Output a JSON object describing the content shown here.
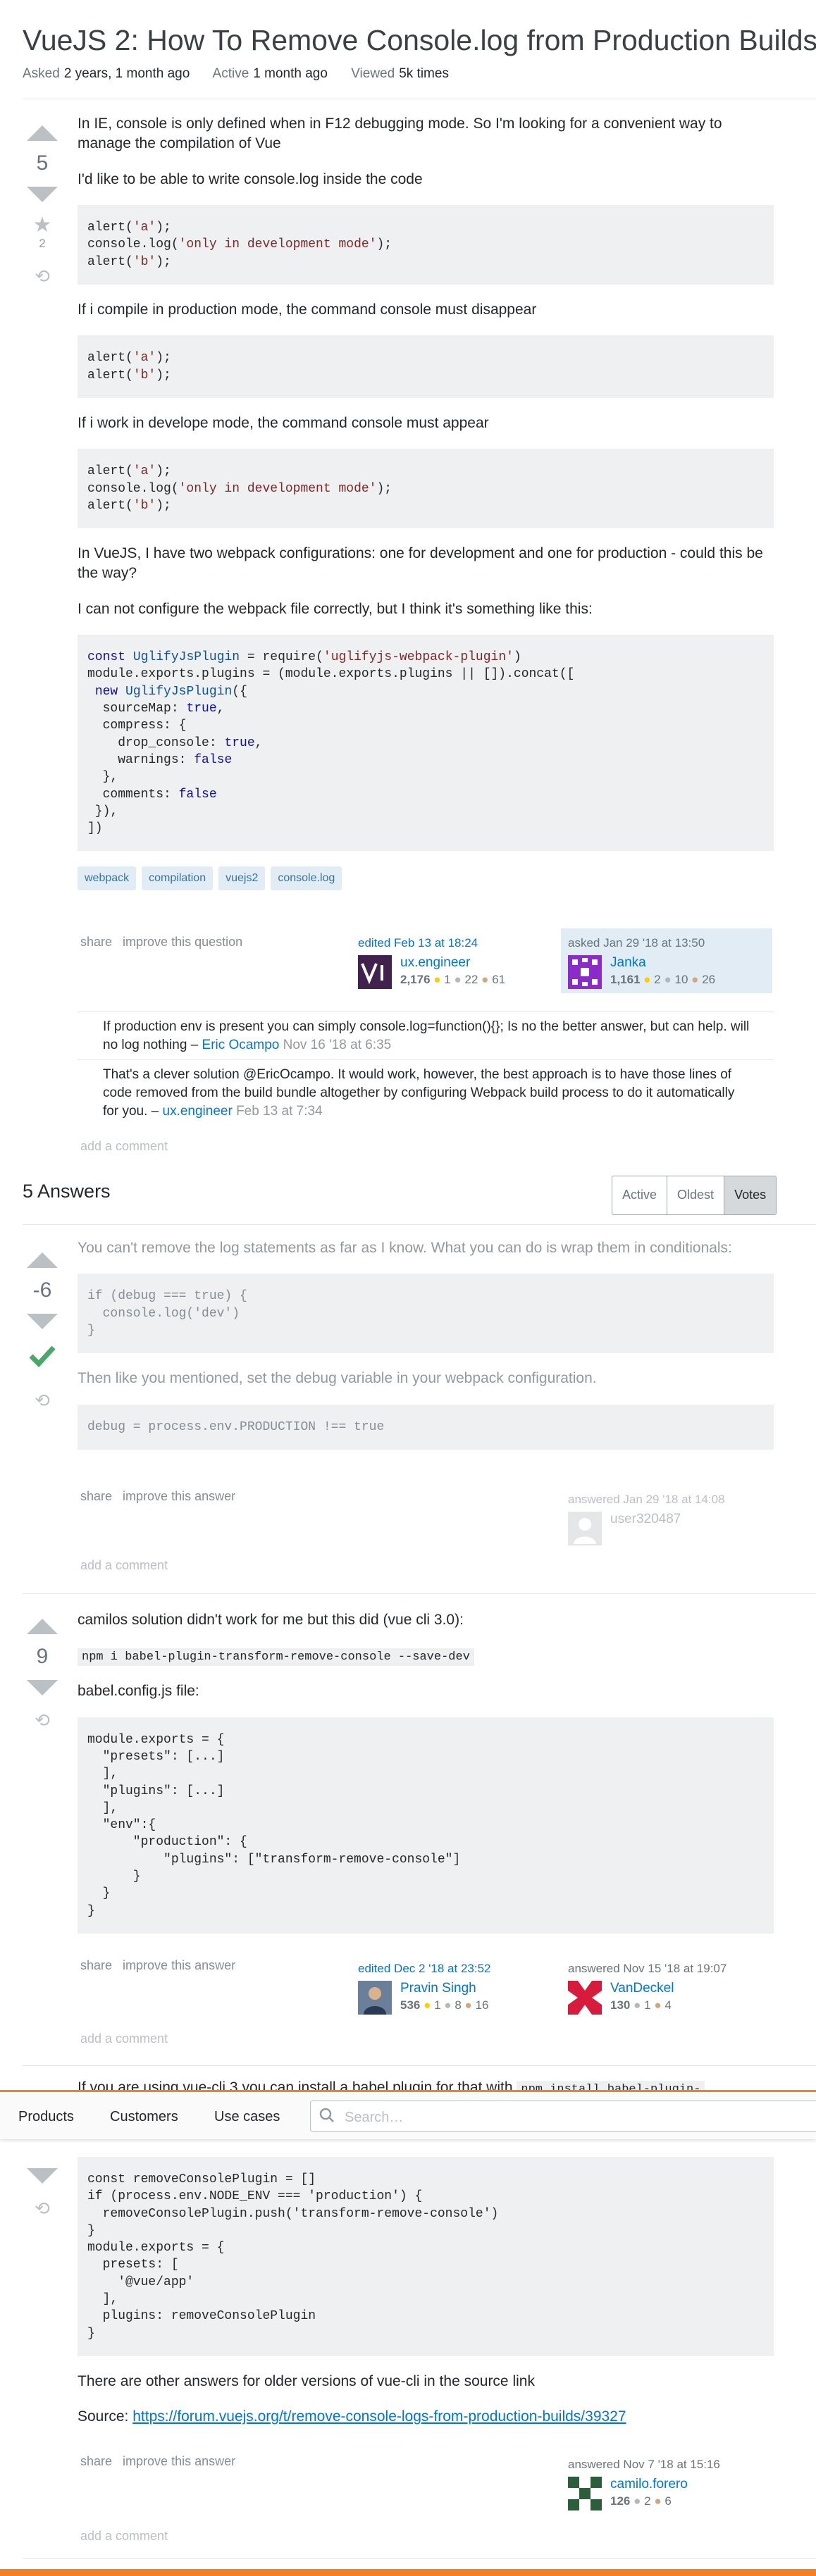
{
  "question": {
    "title": "VueJS 2: How To Remove Console.log from Production Builds?",
    "meta": [
      {
        "label": "Asked",
        "value": "2 years, 1 month ago"
      },
      {
        "label": "Active",
        "value": "1 month ago"
      },
      {
        "label": "Viewed",
        "value": "5k times"
      }
    ],
    "score": "5",
    "fav_count": "2",
    "p1": "In IE, console is only defined when in F12 debugging mode. So I'm looking for a convenient way to manage the compilation of Vue",
    "p2": "I'd like to be able to write console.log inside the code",
    "p3": "If i compile in production mode, the command console must disappear",
    "p4": "If i work in develope mode, the command console must appear",
    "p5": "In VueJS, I have two webpack configurations: one for development and one for production - could this be the way?",
    "p6": "I can not configure the webpack file correctly, but I think it's something like this:",
    "tags": [
      "webpack",
      "compilation",
      "vuejs2",
      "console.log"
    ],
    "actions": {
      "share": "share",
      "improve": "improve this question"
    },
    "editor": {
      "caption": "edited Feb 13 at 18:24",
      "name": "ux.engineer",
      "rep": "2,176",
      "gold": "1",
      "silver": "22",
      "bronze": "61"
    },
    "asker": {
      "caption": "asked Jan 29 '18 at 13:50",
      "name": "Janka",
      "rep": "1,161",
      "gold": "2",
      "silver": "10",
      "bronze": "26"
    },
    "comments": [
      {
        "text": "If production env is present you can simply console.log=function(){}; Is no the better answer, but can help. will no log nothing –",
        "user": "Eric Ocampo",
        "time": "Nov 16 '18 at 6:35"
      },
      {
        "text": "That's a clever solution @EricOcampo. It would work, however, the best approach is to have those lines of code removed from the build bundle altogether by configuring Webpack build process to do it automatically for you. –",
        "user": "ux.engineer",
        "time": "Feb 13 at 7:34"
      }
    ],
    "add_comment": "add a comment"
  },
  "answers_header": {
    "count_label": "5 Answers",
    "tabs": [
      {
        "label": "Active"
      },
      {
        "label": "Oldest"
      },
      {
        "label": "Votes"
      }
    ]
  },
  "answer1": {
    "score": "-6",
    "p1": "You can't remove the log statements as far as I know. What you can do is wrap them in conditionals:",
    "p2": "Then like you mentioned, set the debug variable in your webpack configuration.",
    "actions": {
      "share": "share",
      "improve": "improve this answer"
    },
    "answerer": {
      "caption": "answered Jan 29 '18 at 14:08",
      "name": "user320487"
    },
    "add_comment": "add a comment"
  },
  "answer2": {
    "score": "9",
    "p1": "camilos solution didn't work for me but this did (vue cli 3.0):",
    "cmd": "npm i babel-plugin-transform-remove-console --save-dev",
    "p2": "babel.config.js file:",
    "actions": {
      "share": "share",
      "improve": "improve this answer"
    },
    "editor": {
      "caption": "edited Dec 2 '18 at 23:52",
      "name": "Pravin Singh",
      "rep": "536",
      "gold": "1",
      "silver": "8",
      "bronze": "16"
    },
    "answerer": {
      "caption": "answered Nov 15 '18 at 19:07",
      "name": "VanDeckel",
      "rep": "130",
      "silver": "1",
      "bronze": "4"
    },
    "add_comment": "add a comment"
  },
  "answer3": {
    "p1": "If you are using vue-cli 3 you can install a babel plugin for that with",
    "cmd": "npm install babel-plugin-",
    "p2": "There are other answers for older versions of vue-cli in the source link",
    "source_label": "Source:",
    "source_link": "https://forum.vuejs.org/t/remove-console-logs-from-production-builds/39327",
    "actions": {
      "share": "share",
      "improve": "improve this answer"
    },
    "answerer": {
      "caption": "answered Nov 7 '18 at 15:16",
      "name": "camilo.forero",
      "rep": "126",
      "silver": "2",
      "bronze": "6"
    },
    "add_comment": "add a comment"
  },
  "topbar": {
    "nav": [
      "Products",
      "Customers",
      "Use cases"
    ],
    "search_placeholder": "Search…"
  },
  "colors": {
    "accent": "#f48024",
    "link": "#0077cc",
    "accepted": "#48a868",
    "tag_bg": "#e1ecf4",
    "code_bg": "#eff0f1"
  }
}
